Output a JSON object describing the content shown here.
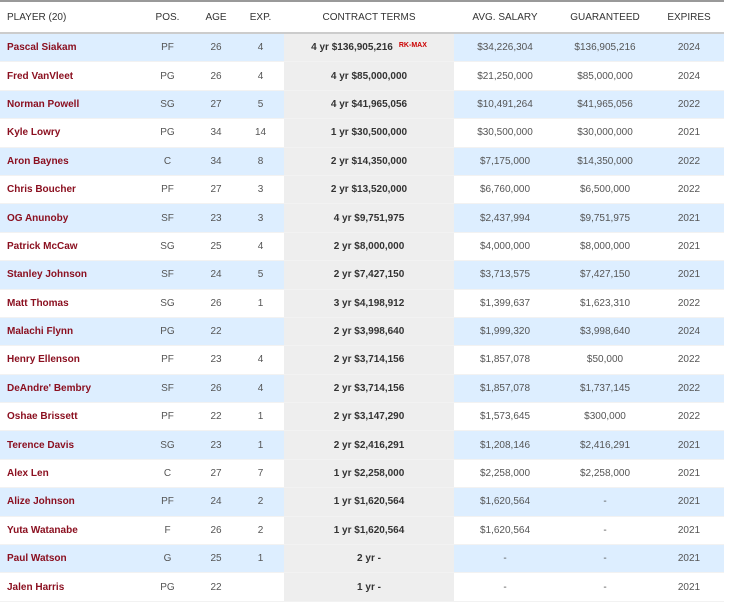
{
  "headers": {
    "player": "PLAYER (20)",
    "pos": "POS.",
    "age": "AGE",
    "exp": "EXP.",
    "contract": "CONTRACT TERMS",
    "avg": "AVG. SALARY",
    "guaranteed": "GUARANTEED",
    "expires": "EXPIRES"
  },
  "rows": [
    {
      "name": "Pascal Siakam",
      "pos": "PF",
      "age": "26",
      "exp": "4",
      "contract": "4 yr $136,905,216",
      "tag": "RK-MAX",
      "avg": "$34,226,304",
      "guaranteed": "$136,905,216",
      "expires": "2024"
    },
    {
      "name": "Fred VanVleet",
      "pos": "PG",
      "age": "26",
      "exp": "4",
      "contract": "4 yr $85,000,000",
      "avg": "$21,250,000",
      "guaranteed": "$85,000,000",
      "expires": "2024"
    },
    {
      "name": "Norman Powell",
      "pos": "SG",
      "age": "27",
      "exp": "5",
      "contract": "4 yr $41,965,056",
      "avg": "$10,491,264",
      "guaranteed": "$41,965,056",
      "expires": "2022"
    },
    {
      "name": "Kyle Lowry",
      "pos": "PG",
      "age": "34",
      "exp": "14",
      "contract": "1 yr $30,500,000",
      "avg": "$30,500,000",
      "guaranteed": "$30,000,000",
      "expires": "2021"
    },
    {
      "name": "Aron Baynes",
      "pos": "C",
      "age": "34",
      "exp": "8",
      "contract": "2 yr $14,350,000",
      "avg": "$7,175,000",
      "guaranteed": "$14,350,000",
      "expires": "2022"
    },
    {
      "name": "Chris Boucher",
      "pos": "PF",
      "age": "27",
      "exp": "3",
      "contract": "2 yr $13,520,000",
      "avg": "$6,760,000",
      "guaranteed": "$6,500,000",
      "expires": "2022"
    },
    {
      "name": "OG Anunoby",
      "pos": "SF",
      "age": "23",
      "exp": "3",
      "contract": "4 yr $9,751,975",
      "avg": "$2,437,994",
      "guaranteed": "$9,751,975",
      "expires": "2021"
    },
    {
      "name": "Patrick McCaw",
      "pos": "SG",
      "age": "25",
      "exp": "4",
      "contract": "2 yr $8,000,000",
      "avg": "$4,000,000",
      "guaranteed": "$8,000,000",
      "expires": "2021"
    },
    {
      "name": "Stanley Johnson",
      "pos": "SF",
      "age": "24",
      "exp": "5",
      "contract": "2 yr $7,427,150",
      "avg": "$3,713,575",
      "guaranteed": "$7,427,150",
      "expires": "2021"
    },
    {
      "name": "Matt Thomas",
      "pos": "SG",
      "age": "26",
      "exp": "1",
      "contract": "3 yr $4,198,912",
      "avg": "$1,399,637",
      "guaranteed": "$1,623,310",
      "expires": "2022"
    },
    {
      "name": "Malachi Flynn",
      "pos": "PG",
      "age": "22",
      "exp": "",
      "contract": "2 yr $3,998,640",
      "avg": "$1,999,320",
      "guaranteed": "$3,998,640",
      "expires": "2024"
    },
    {
      "name": "Henry Ellenson",
      "pos": "PF",
      "age": "23",
      "exp": "4",
      "contract": "2 yr $3,714,156",
      "avg": "$1,857,078",
      "guaranteed": "$50,000",
      "expires": "2022"
    },
    {
      "name": "DeAndre' Bembry",
      "pos": "SF",
      "age": "26",
      "exp": "4",
      "contract": "2 yr $3,714,156",
      "avg": "$1,857,078",
      "guaranteed": "$1,737,145",
      "expires": "2022"
    },
    {
      "name": "Oshae Brissett",
      "pos": "PF",
      "age": "22",
      "exp": "1",
      "contract": "2 yr $3,147,290",
      "avg": "$1,573,645",
      "guaranteed": "$300,000",
      "expires": "2022"
    },
    {
      "name": "Terence Davis",
      "pos": "SG",
      "age": "23",
      "exp": "1",
      "contract": "2 yr $2,416,291",
      "avg": "$1,208,146",
      "guaranteed": "$2,416,291",
      "expires": "2021"
    },
    {
      "name": "Alex Len",
      "pos": "C",
      "age": "27",
      "exp": "7",
      "contract": "1 yr $2,258,000",
      "avg": "$2,258,000",
      "guaranteed": "$2,258,000",
      "expires": "2021"
    },
    {
      "name": "Alize Johnson",
      "pos": "PF",
      "age": "24",
      "exp": "2",
      "contract": "1 yr $1,620,564",
      "avg": "$1,620,564",
      "guaranteed": "-",
      "expires": "2021"
    },
    {
      "name": "Yuta Watanabe",
      "pos": "F",
      "age": "26",
      "exp": "2",
      "contract": "1 yr $1,620,564",
      "avg": "$1,620,564",
      "guaranteed": "-",
      "expires": "2021"
    },
    {
      "name": "Paul Watson",
      "pos": "G",
      "age": "25",
      "exp": "1",
      "contract": "2 yr -",
      "avg": "-",
      "guaranteed": "-",
      "expires": "2021"
    },
    {
      "name": "Jalen Harris",
      "pos": "PG",
      "age": "22",
      "exp": "",
      "contract": "1 yr -",
      "avg": "-",
      "guaranteed": "-",
      "expires": "2021"
    }
  ]
}
